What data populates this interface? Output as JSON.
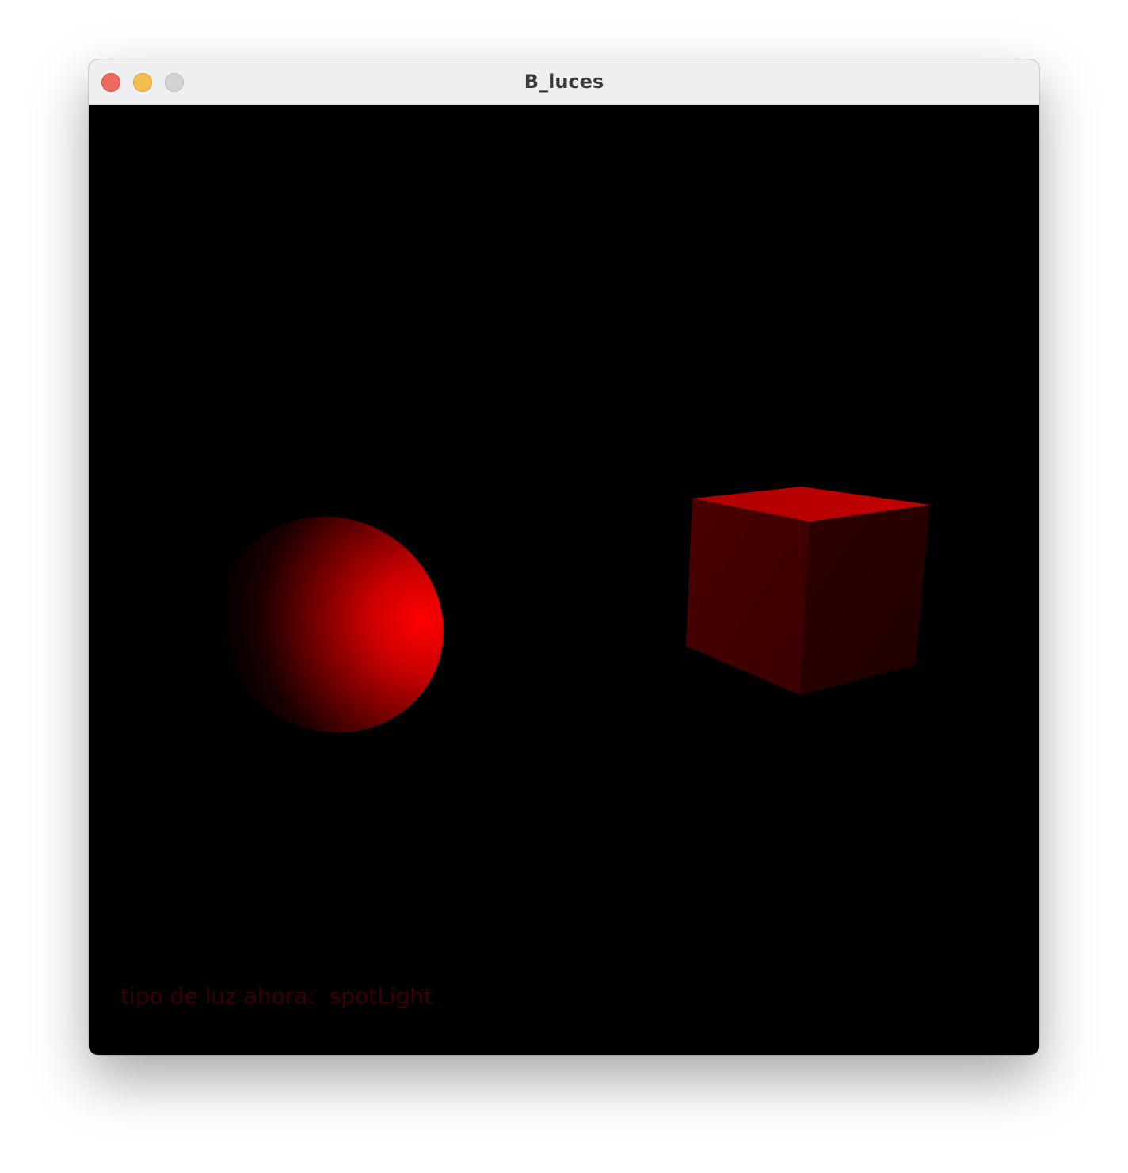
{
  "window": {
    "title": "B_luces"
  },
  "scene": {
    "objects": [
      "sphere",
      "cube"
    ],
    "object_color": "#ff0000",
    "background_color": "#000000"
  },
  "overlay": {
    "label": "tipo de luz ahora:",
    "light_type": "spotLight",
    "text_color": "#3a0000"
  }
}
